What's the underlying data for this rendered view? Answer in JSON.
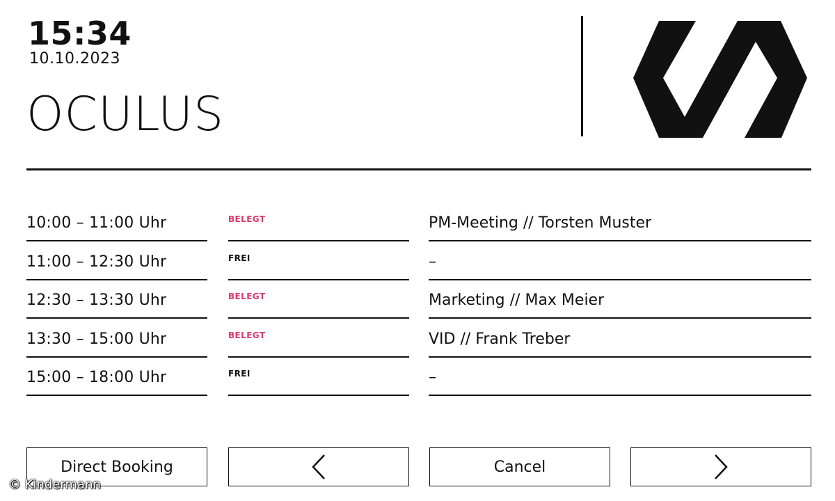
{
  "header": {
    "time": "15:34",
    "date": "10.10.2023",
    "room_name": "OCULUS"
  },
  "schedule": [
    {
      "time": "10:00 – 11:00 Uhr",
      "status": "BELEGT",
      "title": "PM-Meeting // Torsten Muster"
    },
    {
      "time": "11:00 – 12:30 Uhr",
      "status": "FREI",
      "title": "–"
    },
    {
      "time": "12:30 – 13:30 Uhr",
      "status": "BELEGT",
      "title": "Marketing // Max Meier"
    },
    {
      "time": "13:30 – 15:00 Uhr",
      "status": "BELEGT",
      "title": "VID // Frank Treber"
    },
    {
      "time": "15:00 – 18:00 Uhr",
      "status": "FREI",
      "title": "–"
    }
  ],
  "buttons": {
    "direct_booking": "Direct Booking",
    "previous_icon": "chevron-left-icon",
    "cancel": "Cancel",
    "next_icon": "chevron-right-icon"
  },
  "credit": "© Kindermann",
  "colors": {
    "busy": "#e0356b",
    "free": "#111111",
    "foreground": "#111111",
    "background": "#ffffff"
  }
}
